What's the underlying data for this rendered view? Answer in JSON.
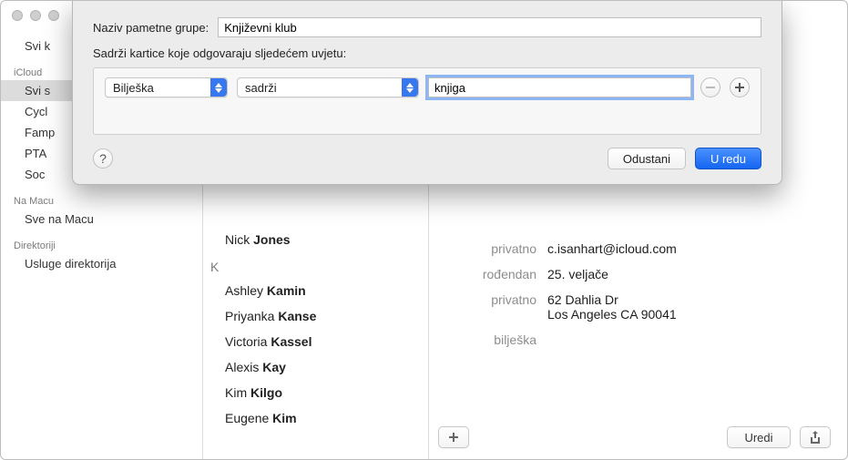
{
  "sidebar": {
    "top_item": "Svi k",
    "section_icloud": {
      "title": "iCloud",
      "items": [
        "Svi s",
        "Cycl",
        "Famp",
        "PTA",
        "Soc"
      ]
    },
    "section_mac": {
      "title": "Na Macu",
      "items": [
        "Sve na Macu"
      ]
    },
    "section_dirs": {
      "title": "Direktoriji",
      "items": [
        "Usluge direktorija"
      ]
    }
  },
  "contacts": {
    "first_visible": {
      "first": "Nick",
      "last": "Jones"
    },
    "letter": "K",
    "people": [
      {
        "first": "Ashley",
        "last": "Kamin"
      },
      {
        "first": "Priyanka",
        "last": "Kanse"
      },
      {
        "first": "Victoria",
        "last": "Kassel"
      },
      {
        "first": "Alexis",
        "last": "Kay"
      },
      {
        "first": "Kim",
        "last": "Kilgo"
      },
      {
        "first": "Eugene",
        "last": "Kim"
      }
    ]
  },
  "detail": {
    "rows": [
      {
        "label": "privatno",
        "value": "c.isanhart@icloud.com"
      },
      {
        "label": "rođendan",
        "value": "25. veljače"
      },
      {
        "label": "privatno",
        "value": "62 Dahlia Dr\nLos Angeles CA 90041"
      },
      {
        "label": "bilješka",
        "value": ""
      }
    ],
    "edit_label": "Uredi"
  },
  "sheet": {
    "name_label": "Naziv pametne grupe:",
    "name_value": "Književni klub",
    "condition_intro": "Sadrži kartice koje odgovaraju sljedećem uvjetu:",
    "rule": {
      "field": "Bilješka",
      "operator": "sadrži",
      "value": "knjiga"
    },
    "cancel": "Odustani",
    "ok": "U redu"
  }
}
